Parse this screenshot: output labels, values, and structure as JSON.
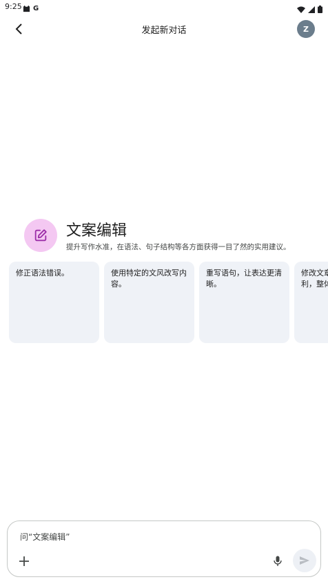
{
  "status_bar": {
    "time": "9:25",
    "left_icons": [
      "cat-notification-icon",
      "google-g-icon"
    ],
    "right_icons": [
      "wifi-icon",
      "signal-icon",
      "battery-icon"
    ]
  },
  "app_bar": {
    "title": "发起新对话",
    "avatar_letter": "Z"
  },
  "gem": {
    "title": "文案编辑",
    "description": "提升写作水准，在语法、句子结构等各方面获得一目了然的实用建议。",
    "icon": "edit-square-icon",
    "icon_color": "#9c2ea8",
    "icon_bg": "#f4c8f2"
  },
  "suggestions": [
    {
      "text": "修正语法错误。"
    },
    {
      "text": "使用特定的文风改写内容。"
    },
    {
      "text": "重写语句，让表达更清晰。"
    },
    {
      "text": "修改文章，让表达更流利，整体"
    }
  ],
  "input": {
    "placeholder": "问“文案编辑”"
  },
  "colors": {
    "card_bg": "#eff2f7",
    "avatar_bg": "#6b7d8c",
    "send_bg": "#edf0f5"
  }
}
